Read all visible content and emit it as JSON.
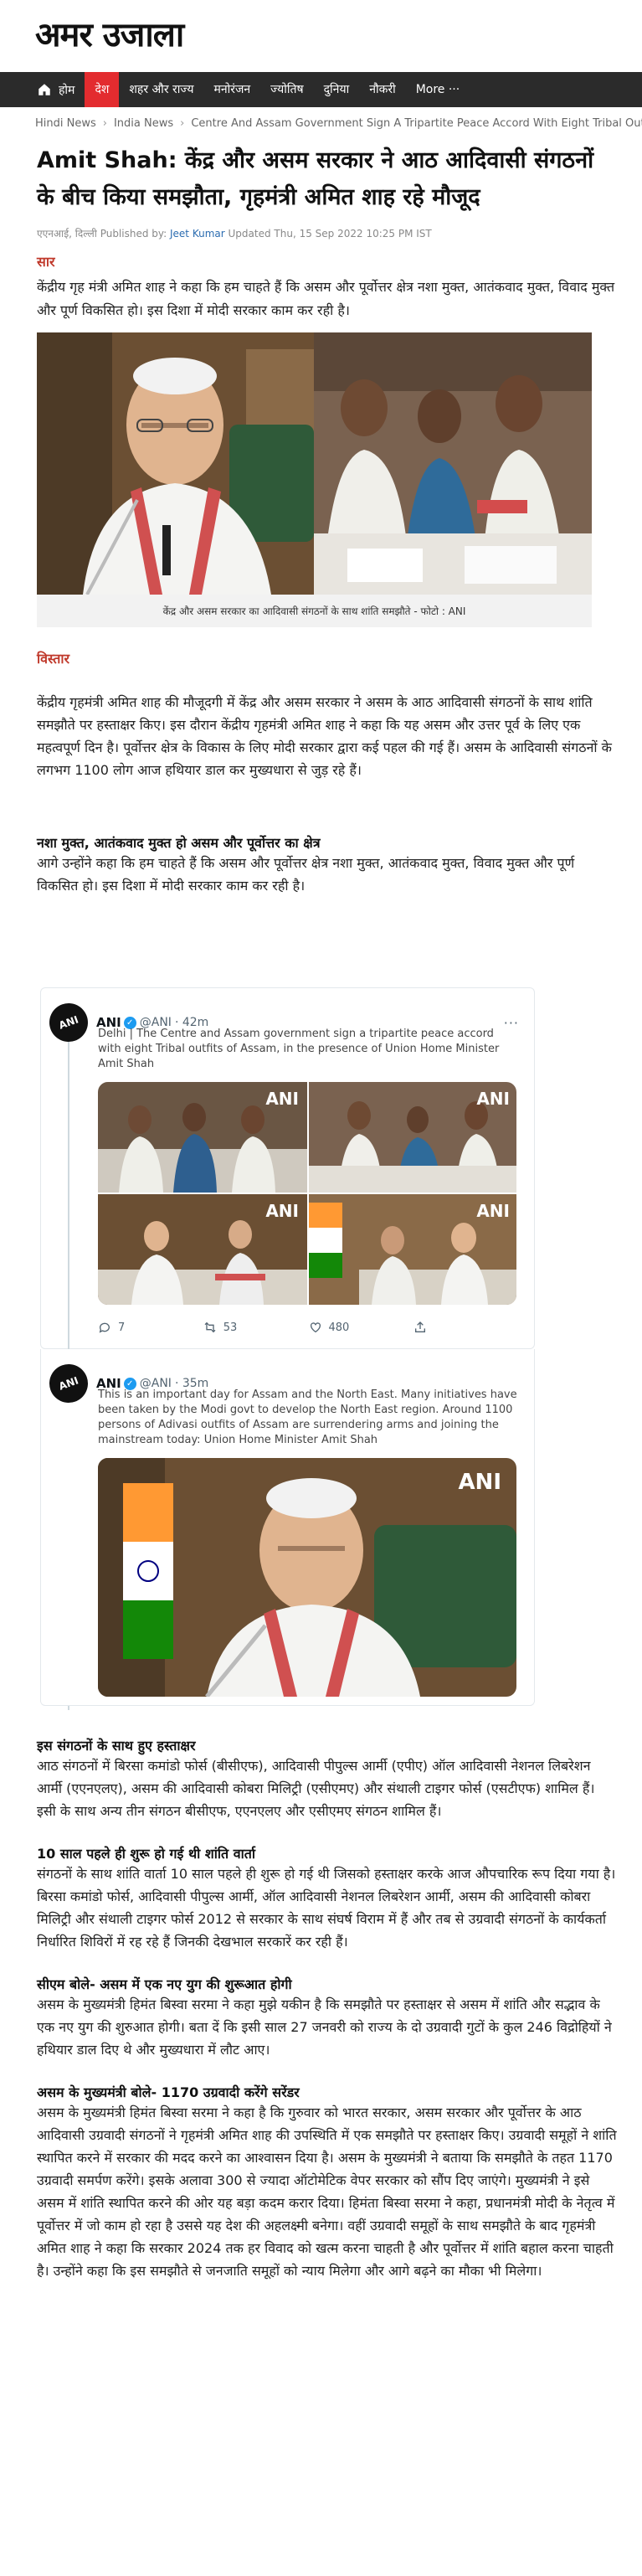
{
  "header": {
    "logo_text": "अमर उजाला",
    "nav": [
      {
        "label": "होम",
        "icon": "home-icon"
      },
      {
        "label": "देश",
        "active": true
      },
      {
        "label": "शहर और राज्य"
      },
      {
        "label": "मनोरंजन"
      },
      {
        "label": "ज्योतिष"
      },
      {
        "label": "दुनिया"
      },
      {
        "label": "नौकरी"
      }
    ],
    "more_label": "More ···"
  },
  "breadcrumb": [
    "Hindi News",
    "India News",
    "Centre And Assam Government Sign A Tripartite Peace Accord With Eight Tribal Outfits"
  ],
  "article": {
    "title": "Amit Shah: केंद्र और असम सरकार ने आठ आदिवासी संगठनों के बीच किया समझौता, गृहमंत्री अमित शाह रहे मौजूद",
    "byline": {
      "place": "एएनआई, दिल्ली",
      "published_by": "Published by:",
      "author": "Jeet Kumar",
      "updated": "Updated Thu, 15 Sep 2022 10:25 PM IST"
    },
    "saar_label": "सार",
    "summary": "केंद्रीय गृह मंत्री अमित शाह ने कहा कि हम चाहते हैं कि असम और पूर्वोत्तर क्षेत्र नशा मुक्त, आतंकवाद मुक्त, विवाद मुक्त और पूर्ण विकसित हो। इस दिशा में मोदी सरकार काम कर रही है।",
    "image_caption": "केंद्र और असम सरकार का आदिवासी संगठनों के साथ शांति समझौते - फोटो : ANI",
    "vistaar_label": "विस्तार",
    "para_1": "केंद्रीय गृहमंत्री अमित शाह की मौजूदगी में केंद्र और असम सरकार ने असम के आठ आदिवासी संगठनों के साथ शांति समझौते पर हस्ताक्षर किए। इस दौरान केंद्रीय गृहमंत्री अमित शाह ने कहा कि यह असम और उत्तर पूर्व के लिए एक महत्वपूर्ण दिन है। पूर्वोत्तर क्षेत्र के विकास के लिए मोदी सरकार द्वारा कई पहल की गई हैं। असम के आदिवासी संगठनों के लगभग 1100 लोग आज हथियार डाल कर मुख्यधारा से जुड़ रहे हैं।",
    "subhead_1": "नशा मुक्त, आतंकवाद मुक्त हो असम और पूर्वोत्तर का क्षेत्र",
    "para_2": "आगे उन्होंने कहा कि हम चाहते हैं कि असम और पूर्वोत्तर क्षेत्र नशा मुक्त, आतंकवाद मुक्त, विवाद मुक्त और पूर्ण विकसित हो। इस दिशा में मोदी सरकार काम कर रही है।",
    "subhead_2": "इस संगठनों के साथ हुए हस्ताक्षर",
    "para_3": "आठ संगठनों में बिरसा कमांडो फोर्स (बीसीएफ), आदिवासी पीपुल्स आर्मी (एपीए) ऑल आदिवासी नेशनल लिबरेशन आर्मी (एएनएलए), असम की आदिवासी कोबरा मिलिट्री (एसीएमए) और संथाली टाइगर फोर्स (एसटीएफ) शामिल हैं। इसी के साथ अन्य तीन संगठन बीसीएफ, एएनएलए और एसीएमए संगठन शामिल हैं।",
    "subhead_3": "10 साल पहले ही शुरू हो गई थी शांति वार्ता",
    "para_4": "संगठनों के साथ शांति वार्ता 10 साल पहले ही शुरू हो गई थी जिसको हस्ताक्षर करके आज औपचारिक रूप दिया गया है। बिरसा कमांडो फोर्स, आदिवासी पीपुल्स आर्मी, ऑल आदिवासी नेशनल लिबरेशन आर्मी, असम की आदिवासी कोबरा मिलिट्री और संथाली टाइगर फोर्स 2012 से सरकार के साथ संघर्ष विराम में हैं और तब से उग्रवादी संगठनों के कार्यकर्ता निर्धारित शिविरों में रह रहे हैं जिनकी देखभाल सरकारें कर रही हैं।",
    "subhead_4": "सीएम बोले- असम में एक नए युग की शुरूआत होगी",
    "para_5": "असम के मुख्यमंत्री हिमंत बिस्वा सरमा ने कहा मुझे यकीन है कि समझौते पर हस्ताक्षर से असम में शांति और सद्भाव के एक नए युग की शुरुआत होगी। बता दें कि इसी साल 27 जनवरी को राज्य के दो उग्रवादी गुटों के कुल 246 विद्रोहियों ने हथियार डाल दिए थे और मुख्यधारा में लौट आए।",
    "subhead_5": "असम के मुख्यमंत्री बोले- 1170 उग्रवादी करेंगे सरेंडर",
    "para_6": "असम के मुख्यमंत्री हिमंत बिस्वा सरमा ने कहा है कि गुरुवार को भारत सरकार, असम सरकार और पूर्वोत्तर के आठ आदिवासी उग्रवादी संगठनों ने गृहमंत्री अमित शाह की उपस्थिति में एक समझौते पर हस्ताक्षर किए। उग्रवादी समूहों ने शांति स्थापित करने में सरकार की मदद करने का आश्वासन दिया है। असम के मुख्यमंत्री ने बताया कि समझौते के तहत 1170 उग्रवादी समर्पण करेंगे। इसके अलावा 300 से ज्यादा ऑटोमेटिक वेपर सरकार को सौंप दिए जाएंगे। मुख्यमंत्री ने इसे असम में शांति स्थापित करने की ओर यह बड़ा कदम करार दिया। हिमंता बिस्वा सरमा ने कहा, प्रधानमंत्री मोदी के नेतृत्व में पूर्वोत्तर में जो काम हो रहा है उससे यह देश की अहलक्ष्मी बनेगा। वहीं उग्रवादी समूहों के साथ समझौते के बाद गृहमंत्री अमित शाह ने कहा कि सरकार 2024 तक हर विवाद को खत्म करना चाहती है और पूर्वोत्तर में शांति बहाल करना चाहती है। उन्होंने कहा कि इस समझौते से जनजाति समूहों को न्याय मिलेगा और आगे बढ़ने का मौका भी मिलेगा।"
  },
  "tweets": [
    {
      "name": "ANI",
      "handle": "@ANI",
      "time": "· 42m",
      "text": "Delhi | The Centre and Assam government sign a tripartite peace accord with eight Tribal outfits of Assam, in the presence of Union Home Minister Amit Shah",
      "replies": "7",
      "retweets": "53",
      "likes": "480",
      "watermark": "ANI"
    },
    {
      "name": "ANI",
      "handle": "@ANI",
      "time": "· 35m",
      "text": "This is an important day for Assam and the North East. Many initiatives have been taken by the Modi govt to develop the North East region. Around 1100 persons of Adivasi outfits of Assam are surrendering arms and joining the mainstream today: Union Home Minister Amit Shah",
      "watermark": "ANI"
    }
  ],
  "avatar_text": "ANI",
  "colors": {
    "nav_bg": "#2b2b2b",
    "nav_active": "#e32c2f",
    "section_label": "#c0392b",
    "link": "#2b6cb0"
  }
}
